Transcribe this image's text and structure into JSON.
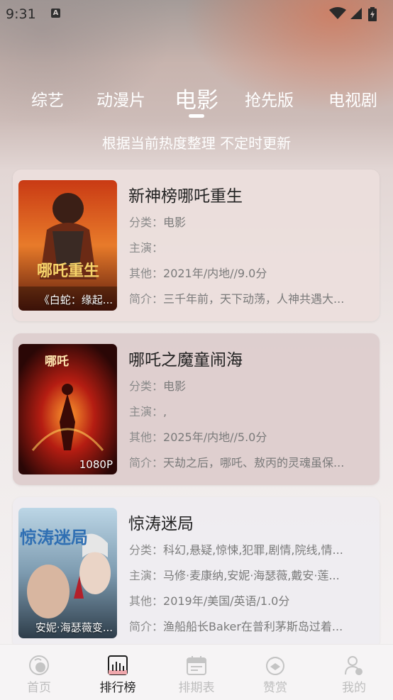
{
  "status_bar": {
    "time": "9:31",
    "notification_glyph": "A"
  },
  "tabs": [
    {
      "label": "综艺",
      "active": false
    },
    {
      "label": "动漫片",
      "active": false
    },
    {
      "label": "电影",
      "active": true
    },
    {
      "label": "抢先版",
      "active": false
    },
    {
      "label": "电视剧",
      "active": false
    }
  ],
  "subtitle": "根据当前热度整理 不定时更新",
  "field_labels": {
    "category": "分类：",
    "cast": "主演：",
    "other": "其他：",
    "intro": "简介："
  },
  "movies": [
    {
      "title": "新神榜哪吒重生",
      "category": "电影",
      "cast": "",
      "other": "2021年/内地//9.0分",
      "intro": "三千年前，天下动荡，人神共遇大...",
      "poster_label": "《白蛇：缘起...",
      "poster_art_text": "哪吒重生"
    },
    {
      "title": "哪吒之魔童闹海",
      "category": "电影",
      "cast": ",",
      "other": "2025年/内地//5.0分",
      "intro": "天劫之后，哪吒、敖丙的灵魂虽保...",
      "poster_label": "1080P",
      "poster_art_text": "哪吒"
    },
    {
      "title": "惊涛迷局",
      "category": "科幻,悬疑,惊悚,犯罪,剧情,院线,情...",
      "cast": "马修·麦康纳,安妮·海瑟薇,戴安·莲...",
      "other": "2019年/美国/英语/1.0分",
      "intro": "渔船船长Baker在普利茅斯岛过着...",
      "poster_label": "安妮·海瑟薇变...",
      "poster_art_text": "惊涛迷局"
    }
  ],
  "bottom_nav": [
    {
      "label": "首页",
      "icon": "home-icon",
      "active": false
    },
    {
      "label": "排行榜",
      "icon": "ranking-icon",
      "active": true
    },
    {
      "label": "排期表",
      "icon": "schedule-icon",
      "active": false
    },
    {
      "label": "赞赏",
      "icon": "appreciate-icon",
      "active": false
    },
    {
      "label": "我的",
      "icon": "profile-icon",
      "active": false
    }
  ],
  "colors": {
    "accent_text": "#ffffff",
    "active_nav": "#1e1e1e",
    "inactive_nav": "#bdbdbd"
  }
}
